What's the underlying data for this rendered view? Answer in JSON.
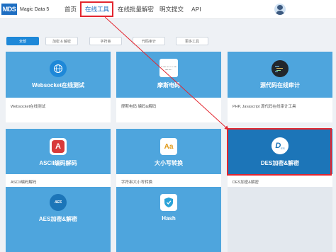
{
  "header": {
    "logo_mark": "MDS",
    "logo_text": "Magic Data 5",
    "nav": [
      {
        "label": "首页"
      },
      {
        "label": "在线工具"
      },
      {
        "label": "在线批量解密"
      },
      {
        "label": "明文提交"
      },
      {
        "label": "API"
      }
    ],
    "active_nav": "在线工具"
  },
  "filters": [
    "全部",
    "加密 & 解密",
    "字符串",
    "代码审计",
    "更多工具"
  ],
  "active_filter": "全部",
  "cards": [
    {
      "title": "Websocket在线测试",
      "desc": "Websocket在线测试",
      "icon": "globe-icon"
    },
    {
      "title": "摩斯电码",
      "desc": "摩斯电码 编码&解码",
      "icon": "morse-code-icon",
      "icon_text": "-- --- .-. ... . -.-. --- -.. ."
    },
    {
      "title": "源代码在线审计",
      "desc": "PHP, Javascript 源代码在线审计工具",
      "icon": "code-terminal-icon"
    },
    {
      "title": "ASCII编码解码",
      "desc": "ASCII编码解码",
      "icon": "ascii-a-icon",
      "icon_text": "A"
    },
    {
      "title": "大小写转换",
      "desc": "字符串大小写转换",
      "icon": "case-convert-icon",
      "icon_text": "Aa"
    },
    {
      "title": "DES加密&解密",
      "desc": "DES加密&解密",
      "icon": "des-icon",
      "icon_text": "D",
      "icon_sub": "ES"
    },
    {
      "title": "AES加密&解密",
      "desc": "",
      "icon": "aes-icon",
      "icon_text": "AES"
    },
    {
      "title": "Hash",
      "desc": "",
      "icon": "hash-shield-icon"
    }
  ],
  "colors": {
    "card_light": "#4ea5dd",
    "card_dark": "#1c75b8",
    "accent": "#1e6ec2",
    "highlight": "#e3262f"
  }
}
